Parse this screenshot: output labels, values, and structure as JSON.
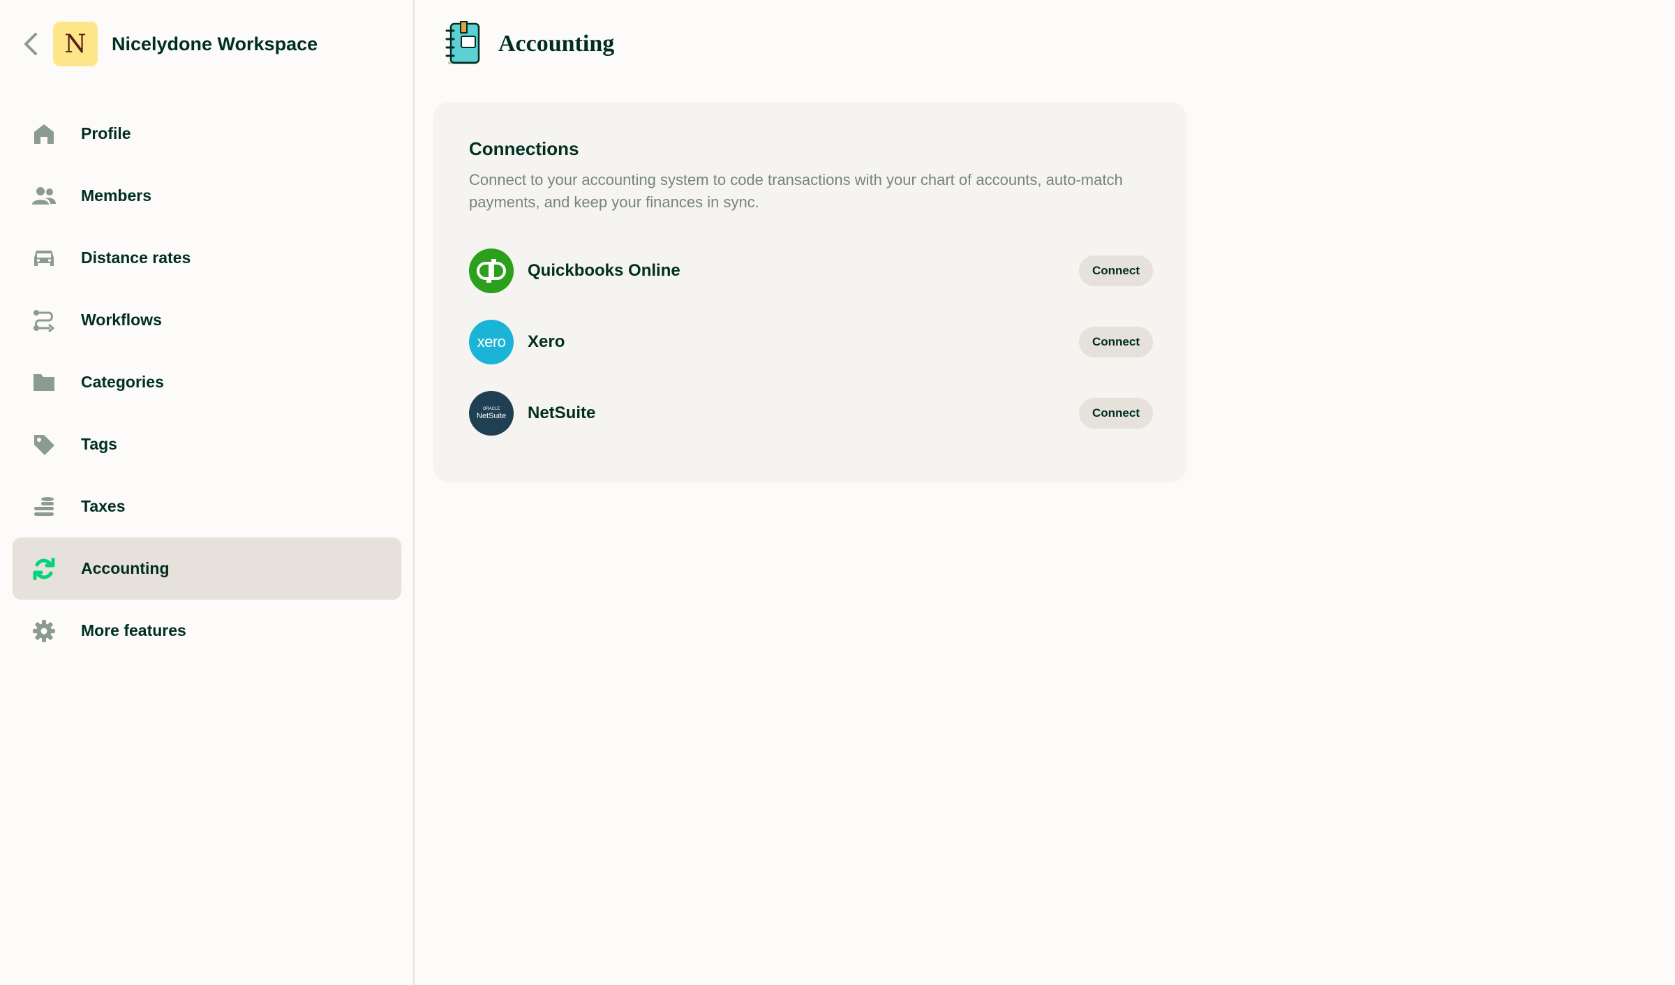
{
  "sidebar": {
    "back_icon": "chevron-left-icon",
    "workspace": {
      "initial": "N",
      "name": "Nicelydone Workspace",
      "avatar_color": "#fde68a"
    },
    "items": [
      {
        "label": "Profile",
        "icon": "home-icon"
      },
      {
        "label": "Members",
        "icon": "users-icon"
      },
      {
        "label": "Distance rates",
        "icon": "car-icon"
      },
      {
        "label": "Workflows",
        "icon": "workflow-icon"
      },
      {
        "label": "Categories",
        "icon": "folder-icon"
      },
      {
        "label": "Tags",
        "icon": "tag-icon"
      },
      {
        "label": "Taxes",
        "icon": "coins-icon"
      },
      {
        "label": "Accounting",
        "icon": "sync-icon",
        "active": true
      },
      {
        "label": "More features",
        "icon": "gear-icon"
      }
    ]
  },
  "main": {
    "title": "Accounting",
    "title_icon": "accounting-notebook-icon"
  },
  "connections": {
    "title": "Connections",
    "description": "Connect to your accounting system to code transactions with your chart of accounts, auto-match payments, and keep your finances in sync.",
    "items": [
      {
        "name": "Quickbooks Online",
        "logo": "quickbooks-logo",
        "logo_text": "qb",
        "color": "#2ca01c",
        "button": "Connect"
      },
      {
        "name": "Xero",
        "logo": "xero-logo",
        "logo_text": "xero",
        "color": "#1ab4d7",
        "button": "Connect"
      },
      {
        "name": "NetSuite",
        "logo": "netsuite-logo",
        "logo_text_top": "ORACLE",
        "logo_text": "NetSuite",
        "color": "#1f3f53",
        "button": "Connect"
      }
    ]
  },
  "colors": {
    "text_primary": "#002e22",
    "text_muted": "#76847e",
    "icon_gray": "#8b9a93",
    "accent_green": "#03d47c",
    "active_bg": "#e6e1da",
    "card_bg": "#f6f4f0"
  }
}
